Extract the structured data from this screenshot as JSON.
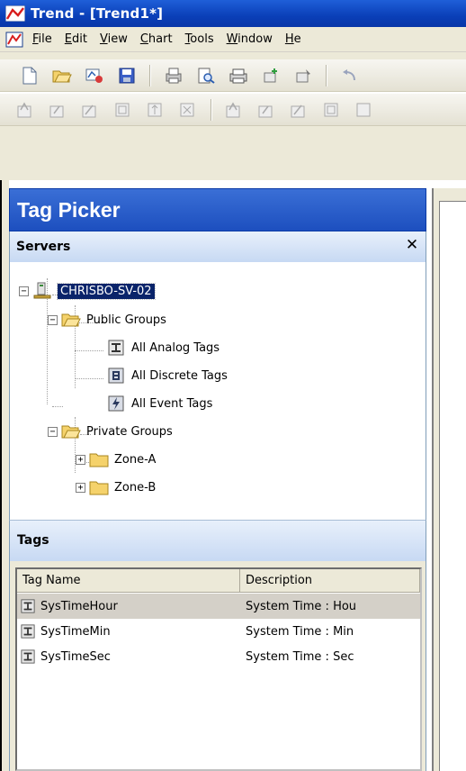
{
  "window": {
    "title": "Trend - [Trend1*]"
  },
  "menu": {
    "items": [
      {
        "label": "File",
        "accel": "F",
        "rest": "ile"
      },
      {
        "label": "Edit",
        "accel": "E",
        "rest": "dit"
      },
      {
        "label": "View",
        "accel": "V",
        "rest": "iew"
      },
      {
        "label": "Chart",
        "accel": "C",
        "rest": "hart"
      },
      {
        "label": "Tools",
        "accel": "T",
        "rest": "ools"
      },
      {
        "label": "Window",
        "accel": "W",
        "rest": "indow"
      },
      {
        "label": "He",
        "accel": "H",
        "rest": "e"
      }
    ]
  },
  "toolbar1": {
    "buttons": [
      "new-icon",
      "open-icon",
      "open-tag-icon",
      "save-icon",
      "print-icon",
      "print-preview-icon",
      "printer-icon",
      "add-tag-icon",
      "tag-props-icon",
      "undo-icon"
    ]
  },
  "toolbar2": {
    "buttons": [
      "trend-up-icon",
      "trend-zoom-icon",
      "trend-scale-icon",
      "trend-fit-icon",
      "trend-pan-icon",
      "trend-compress-icon",
      "trend-up2-icon",
      "trend-zoom2-icon",
      "trend-scale2-icon",
      "trend-fit2-icon",
      "trend-more-icon"
    ]
  },
  "tag_picker": {
    "title": "Tag Picker",
    "servers_label": "Servers",
    "close_glyph": "✕",
    "tree": {
      "server": "CHRISBO-SV-02",
      "public_groups": "Public Groups",
      "public_items": [
        "All Analog Tags",
        "All Discrete Tags",
        "All Event Tags"
      ],
      "private_groups": "Private Groups",
      "private_items": [
        "Zone-A",
        "Zone-B"
      ]
    },
    "tags_label": "Tags",
    "columns": [
      "Tag Name",
      "Description"
    ],
    "rows": [
      {
        "name": "SysTimeHour",
        "description": "System Time : Hou"
      },
      {
        "name": "SysTimeMin",
        "description": "System Time : Min"
      },
      {
        "name": "SysTimeSec",
        "description": "System Time : Sec"
      }
    ]
  },
  "colors": {
    "title_bar": "#0a3fb8",
    "panel_header": "#1d4fbf",
    "selection": "#0a246a",
    "chrome": "#ece9d8"
  }
}
